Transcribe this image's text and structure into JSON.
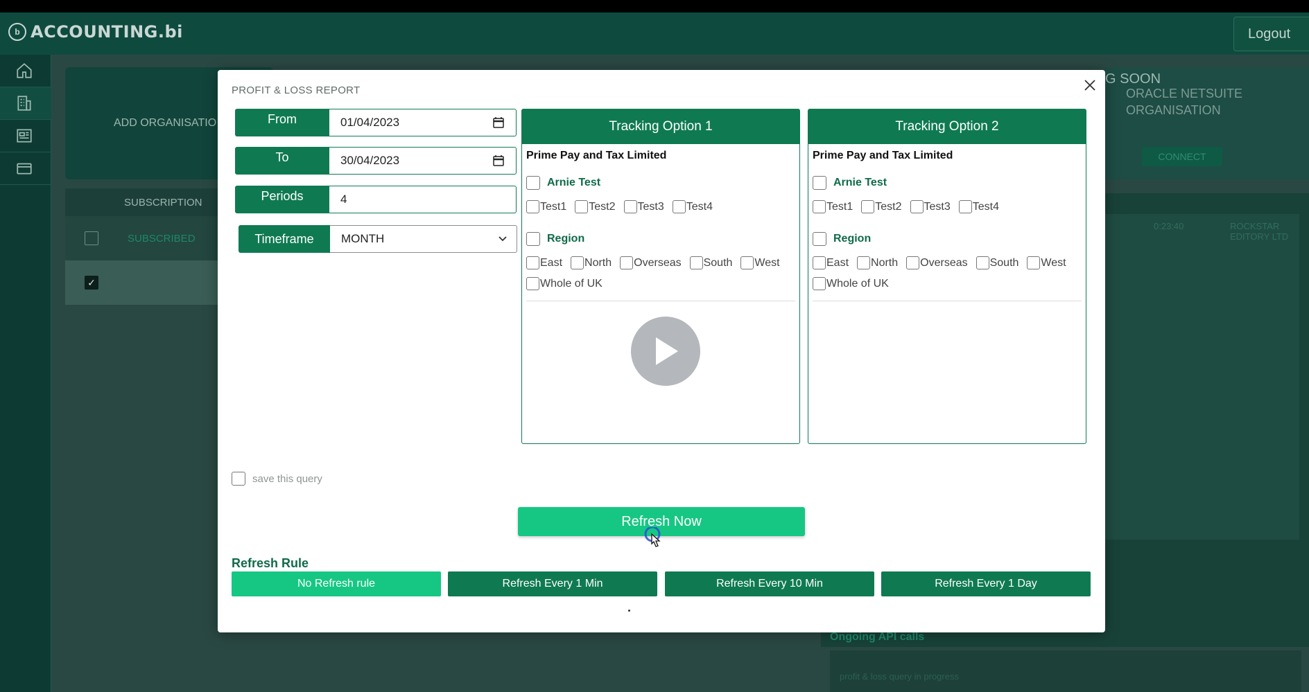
{
  "app": {
    "logo_text": "ACCOUNTING.bi",
    "logout_label": "Logout"
  },
  "background": {
    "add_org_label": "ADD ORGANISATIO",
    "coming_soon": "G SOON",
    "netsuite_line1": "ORACLE NETSUITE",
    "netsuite_line2": "ORGANISATION",
    "connect_label": "CONNECT",
    "subscription_header": "SUBSCRIPTION",
    "row1_status": "SUBSCRIBED",
    "right_col1": "0:23:40",
    "right_col2": "ROCKSTAR EDITORY LTD",
    "ongoing_title": "Ongoing API calls",
    "ongoing_text": "profit & loss query in progress"
  },
  "modal": {
    "title": "PROFIT & LOSS REPORT",
    "from_label": "From",
    "from_value": "01/04/2023",
    "to_label": "To",
    "to_value": "30/04/2023",
    "periods_label": "Periods",
    "periods_value": "4",
    "timeframe_label": "Timeframe",
    "timeframe_value": "MONTH",
    "save_query_label": "save this query",
    "refresh_now_label": "Refresh Now",
    "refresh_rule_title": "Refresh Rule",
    "refresh_rules": [
      "No Refresh rule",
      "Refresh Every 1 Min",
      "Refresh Every 10 Min",
      "Refresh Every 1 Day"
    ],
    "tracking": [
      {
        "title": "Tracking Option 1",
        "org": "Prime Pay and Tax Limited",
        "category1": "Arnie Test",
        "options1": [
          "Test1",
          "Test2",
          "Test3",
          "Test4"
        ],
        "category2": "Region",
        "options2": [
          "East",
          "North",
          "Overseas",
          "South",
          "West"
        ],
        "options3": [
          "Whole of UK"
        ]
      },
      {
        "title": "Tracking Option 2",
        "org": "Prime Pay and Tax Limited",
        "category1": "Arnie Test",
        "options1": [
          "Test1",
          "Test2",
          "Test3",
          "Test4"
        ],
        "category2": "Region",
        "options2": [
          "East",
          "North",
          "Overseas",
          "South",
          "West"
        ],
        "options3": [
          "Whole of UK"
        ]
      }
    ]
  }
}
